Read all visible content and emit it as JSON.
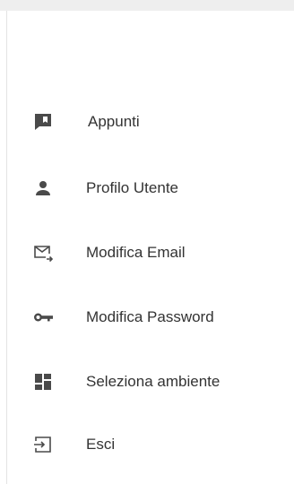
{
  "menu": {
    "items": [
      {
        "label": "Appunti",
        "icon": "notes-icon"
      },
      {
        "label": "Profilo Utente",
        "icon": "person-icon"
      },
      {
        "label": "Modifica Email",
        "icon": "email-forward-icon"
      },
      {
        "label": "Modifica Password",
        "icon": "key-icon"
      },
      {
        "label": "Seleziona ambiente",
        "icon": "dashboard-icon"
      },
      {
        "label": "Esci",
        "icon": "logout-icon"
      }
    ]
  },
  "colors": {
    "icon": "#4a4a4a",
    "text": "#333333",
    "topbar": "#eeeeee",
    "divider": "#e3e3e3"
  }
}
